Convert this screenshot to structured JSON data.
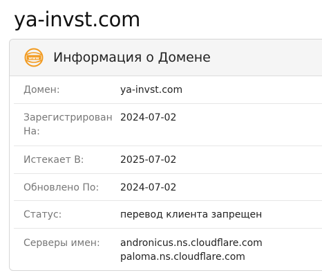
{
  "page": {
    "title": "ya-invst.com"
  },
  "card": {
    "icon": "www-globe-icon",
    "title": "Информация о Домене",
    "accent_color": "#f29a1f"
  },
  "rows": [
    {
      "label": "Домен:",
      "value": "ya-invst.com"
    },
    {
      "label": "Зарегистрирован На:",
      "value": "2024-07-02"
    },
    {
      "label": "Истекает В:",
      "value": "2025-07-02"
    },
    {
      "label": "Обновлено По:",
      "value": "2024-07-02"
    },
    {
      "label": "Статус:",
      "value": "перевод клиента запрещен"
    },
    {
      "label": "Серверы имен:",
      "values": [
        "andronicus.ns.cloudflare.com",
        "paloma.ns.cloudflare.com"
      ]
    }
  ]
}
